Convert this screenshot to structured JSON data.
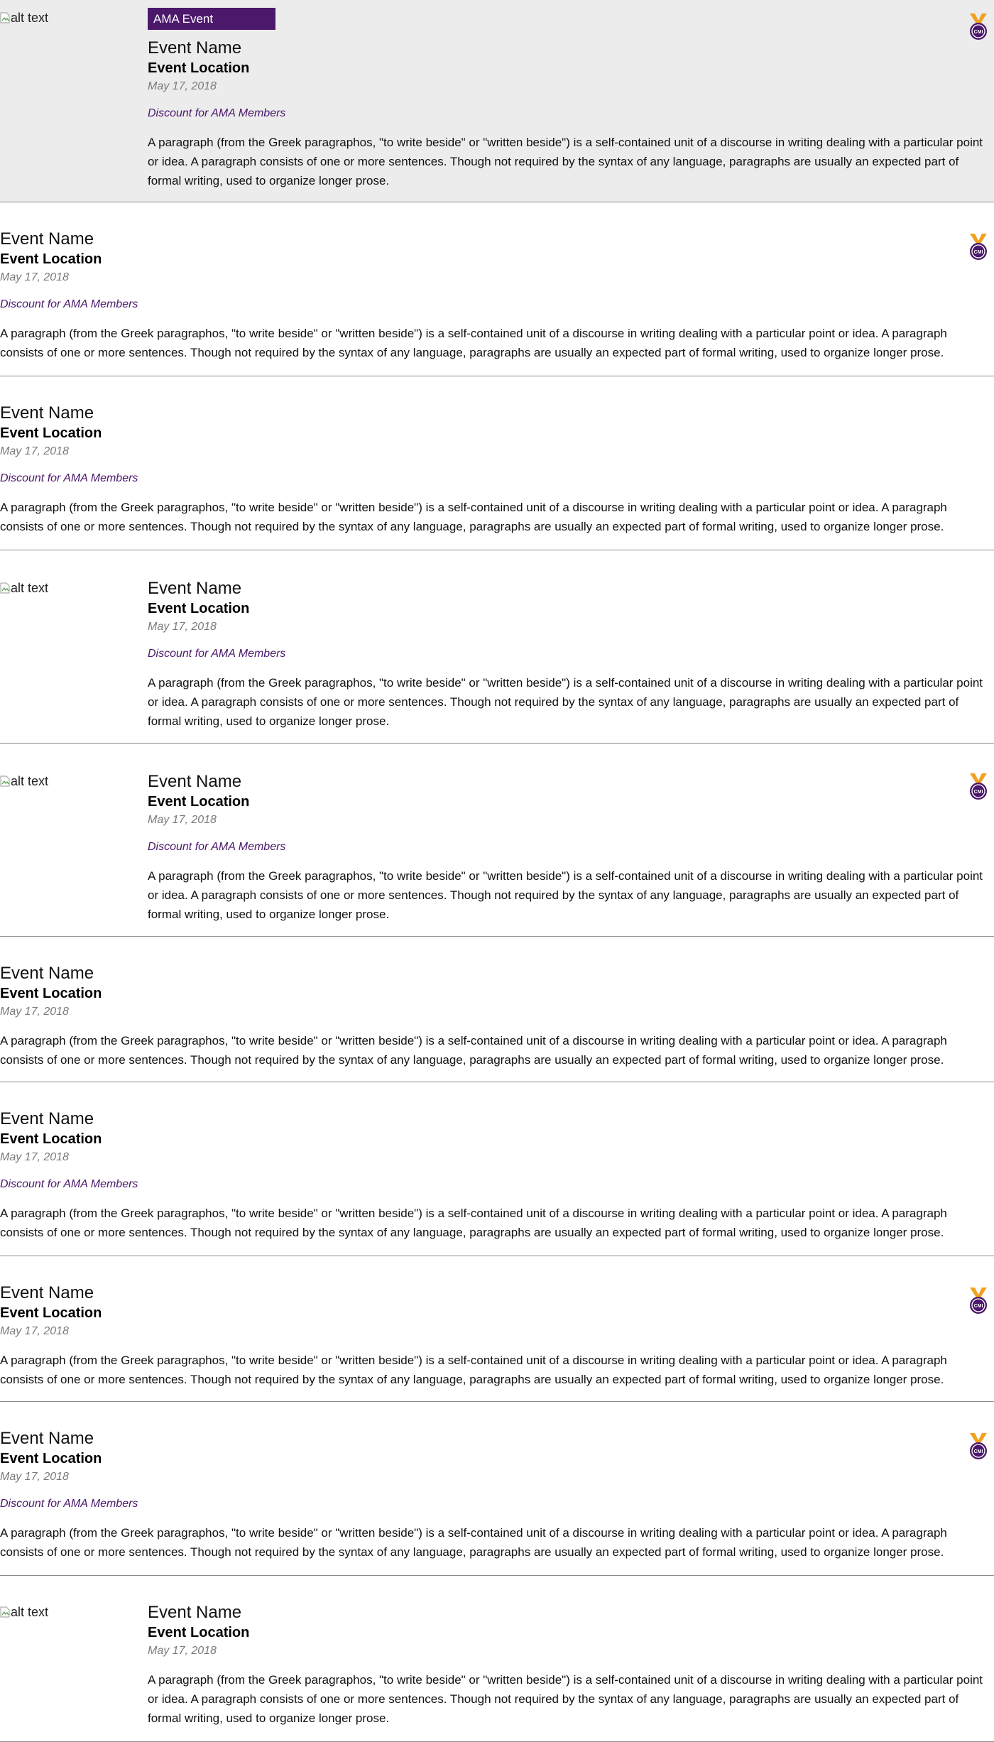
{
  "colors": {
    "accent": "#4b186c",
    "medal": "#f0a21f",
    "featured_bg": "#ececec"
  },
  "events": [
    {
      "featured": true,
      "tag": "AMA Event",
      "image_alt": "alt text",
      "badge": "cmi-medal-icon",
      "name": "Event Name",
      "location": "Event Location",
      "date": "May 17, 2018",
      "discount": "Discount for AMA Members",
      "description": "A paragraph (from the Greek paragraphos, \"to write beside\" or \"written beside\") is a self-contained unit of a discourse in writing dealing with a particular point or idea. A paragraph consists of one or more sentences. Though not required by the syntax of any language, paragraphs are usually an expected part of formal writing, used to organize longer prose."
    },
    {
      "badge": "cmi-medal-icon",
      "name": "Event Name",
      "location": "Event Location",
      "date": "May 17, 2018",
      "discount": "Discount for AMA Members",
      "description": "A paragraph (from the Greek paragraphos, \"to write beside\" or \"written beside\") is a self-contained unit of a discourse in writing dealing with a particular point or idea. A paragraph consists of one or more sentences. Though not required by the syntax of any language, paragraphs are usually an expected part of formal writing, used to organize longer prose."
    },
    {
      "name": "Event Name",
      "location": "Event Location",
      "date": "May 17, 2018",
      "discount": "Discount for AMA Members",
      "description": "A paragraph (from the Greek paragraphos, \"to write beside\" or \"written beside\") is a self-contained unit of a discourse in writing dealing with a particular point or idea. A paragraph consists of one or more sentences. Though not required by the syntax of any language, paragraphs are usually an expected part of formal writing, used to organize longer prose."
    },
    {
      "image_alt": "alt text",
      "name": "Event Name",
      "location": "Event Location",
      "date": "May 17, 2018",
      "discount": "Discount for AMA Members",
      "description": "A paragraph (from the Greek paragraphos, \"to write beside\" or \"written beside\") is a self-contained unit of a discourse in writing dealing with a particular point or idea. A paragraph consists of one or more sentences. Though not required by the syntax of any language, paragraphs are usually an expected part of formal writing, used to organize longer prose."
    },
    {
      "image_alt": "alt text",
      "badge": "cmi-medal-icon",
      "name": "Event Name",
      "location": "Event Location",
      "date": "May 17, 2018",
      "discount": "Discount for AMA Members",
      "description": "A paragraph (from the Greek paragraphos, \"to write beside\" or \"written beside\") is a self-contained unit of a discourse in writing dealing with a particular point or idea. A paragraph consists of one or more sentences. Though not required by the syntax of any language, paragraphs are usually an expected part of formal writing, used to organize longer prose."
    },
    {
      "name": "Event Name",
      "location": "Event Location",
      "date": "May 17, 2018",
      "description": "A paragraph (from the Greek paragraphos, \"to write beside\" or \"written beside\") is a self-contained unit of a discourse in writing dealing with a particular point or idea. A paragraph consists of one or more sentences. Though not required by the syntax of any language, paragraphs are usually an expected part of formal writing, used to organize longer prose."
    },
    {
      "name": "Event Name",
      "location": "Event Location",
      "date": "May 17, 2018",
      "discount": "Discount for AMA Members",
      "description": "A paragraph (from the Greek paragraphos, \"to write beside\" or \"written beside\") is a self-contained unit of a discourse in writing dealing with a particular point or idea. A paragraph consists of one or more sentences. Though not required by the syntax of any language, paragraphs are usually an expected part of formal writing, used to organize longer prose."
    },
    {
      "badge": "cmi-medal-icon",
      "name": "Event Name",
      "location": "Event Location",
      "date": "May 17, 2018",
      "description": "A paragraph (from the Greek paragraphos, \"to write beside\" or \"written beside\") is a self-contained unit of a discourse in writing dealing with a particular point or idea. A paragraph consists of one or more sentences. Though not required by the syntax of any language, paragraphs are usually an expected part of formal writing, used to organize longer prose."
    },
    {
      "badge": "cmi-medal-icon",
      "name": "Event Name",
      "location": "Event Location",
      "date": "May 17, 2018",
      "discount": "Discount for AMA Members",
      "description": "A paragraph (from the Greek paragraphos, \"to write beside\" or \"written beside\") is a self-contained unit of a discourse in writing dealing with a particular point or idea. A paragraph consists of one or more sentences. Though not required by the syntax of any language, paragraphs are usually an expected part of formal writing, used to organize longer prose."
    },
    {
      "image_alt": "alt text",
      "name": "Event Name",
      "location": "Event Location",
      "date": "May 17, 2018",
      "description": "A paragraph (from the Greek paragraphos, \"to write beside\" or \"written beside\") is a self-contained unit of a discourse in writing dealing with a particular point or idea. A paragraph consists of one or more sentences. Though not required by the syntax of any language, paragraphs are usually an expected part of formal writing, used to organize longer prose."
    }
  ]
}
